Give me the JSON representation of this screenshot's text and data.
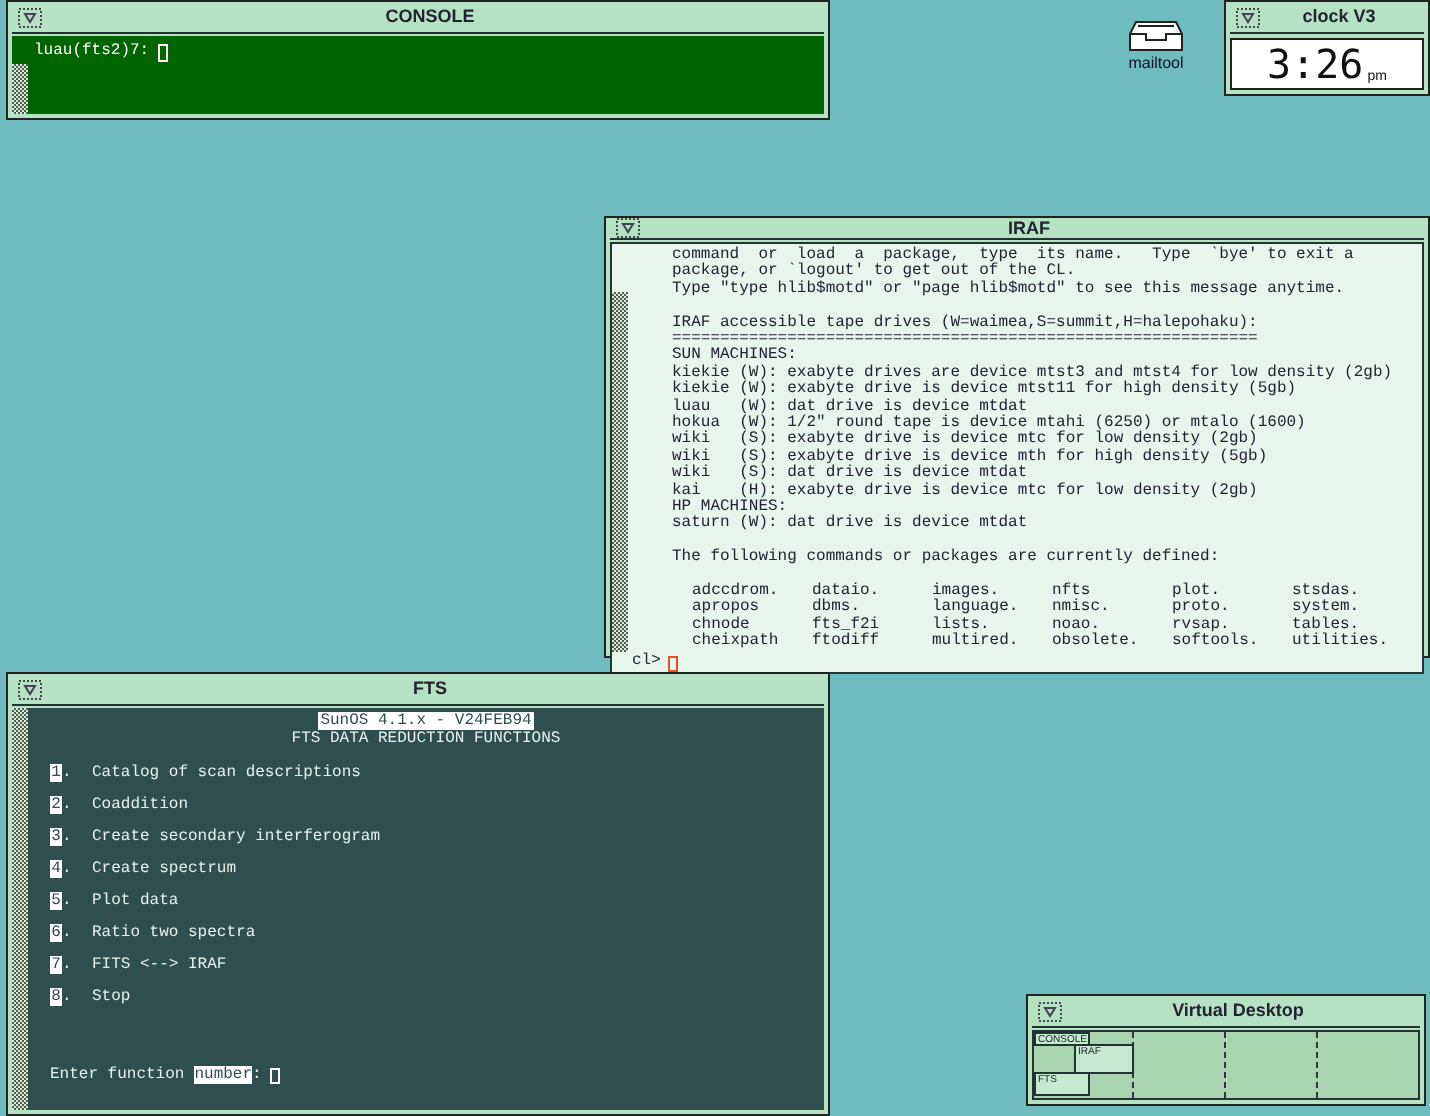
{
  "console": {
    "title": "CONSOLE",
    "prompt": "luau(fts2)7:"
  },
  "mailtool": {
    "label": "mailtool"
  },
  "clock": {
    "title": "clock V3",
    "time": "3:26",
    "meridiem": "pm"
  },
  "iraf": {
    "title": "IRAF",
    "lines": [
      "command  or  load  a  package,  type  its name.   Type  `bye' to exit a",
      "package, or `logout' to get out of the CL.",
      "Type \"type hlib$motd\" or \"page hlib$motd\" to see this message anytime.",
      {
        "text": "IRAF accessible tape drives (W=waimea,S=summit,H=halepohaku):",
        "gap_before": true
      },
      "=============================================================",
      "SUN MACHINES:",
      "kiekie (W): exabyte drives are device mtst3 and mtst4 for low density (2gb)",
      "kiekie (W): exabyte drive is device mtst11 for high density (5gb)",
      "luau   (W): dat drive is device mtdat",
      "hokua  (W): 1/2\" round tape is device mtahi (6250) or mtalo (1600)",
      "wiki   (S): exabyte drive is device mtc for low density (2gb)",
      "wiki   (S): exabyte drive is device mth for high density (5gb)",
      "wiki   (S): dat drive is device mtdat",
      "kai    (H): exabyte drive is device mtc for low density (2gb)",
      "HP MACHINES:",
      "saturn (W): dat drive is device mtdat",
      {
        "text": "The following commands or packages are currently defined:",
        "gap_before": true
      }
    ],
    "packages": [
      [
        "adccdrom.",
        "dataio.",
        "images.",
        "nfts",
        "plot.",
        "stsdas."
      ],
      [
        "apropos",
        "dbms.",
        "language.",
        "nmisc.",
        "proto.",
        "system."
      ],
      [
        "chnode",
        "fts_f2i",
        "lists.",
        "noao.",
        "rvsap.",
        "tables."
      ],
      [
        "cheixpath",
        "ftodiff",
        "multired.",
        "obsolete.",
        "softools.",
        "utilities."
      ]
    ],
    "prompt": "cl>"
  },
  "fts": {
    "title": "FTS",
    "version": "SunOS 4.1.x - V24FEB94",
    "heading": "FTS DATA REDUCTION FUNCTIONS",
    "items": [
      {
        "number": "1",
        "punct": ".",
        "label": "Catalog of scan descriptions"
      },
      {
        "number": "2",
        "punct": ".",
        "label": "Coaddition"
      },
      {
        "number": "3",
        "punct": ".",
        "label": "Create secondary interferogram"
      },
      {
        "number": "4",
        "punct": ".",
        "label": "Create spectrum"
      },
      {
        "number": "5",
        "punct": ".",
        "label": "Plot data"
      },
      {
        "number": "6",
        "punct": ".",
        "label": "Ratio two spectra"
      },
      {
        "number": "7",
        "punct": ".",
        "label": "FITS <--> IRAF"
      },
      {
        "number": "8",
        "punct": ".",
        "label": "Stop"
      }
    ],
    "prompt": "Enter function",
    "prompt_highlight": "number",
    "prompt_end": ":"
  },
  "virtual_desktop": {
    "title": "Virtual Desktop",
    "windows": [
      "CONSOLE",
      "IRAF",
      "FTS"
    ]
  }
}
